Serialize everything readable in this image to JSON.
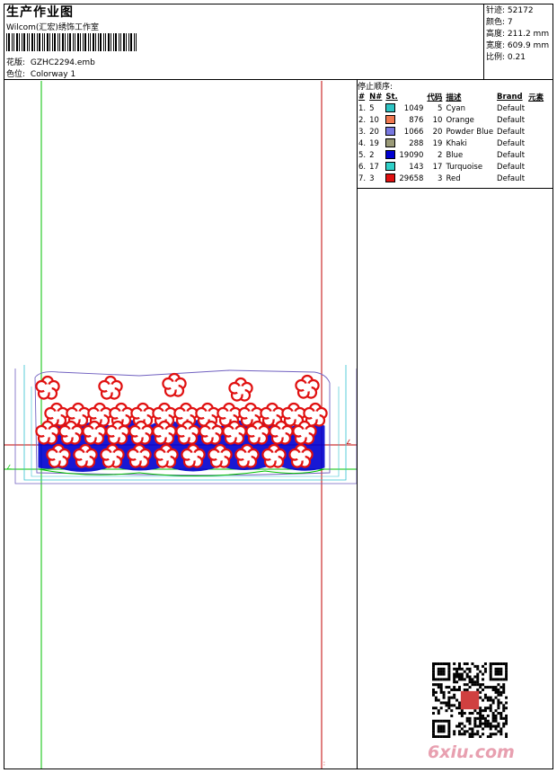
{
  "header": {
    "title": "生产作业图",
    "company": "Wilcom(汇宏)绣饰工作室",
    "pattern_label": "花版:",
    "pattern_value": "GZHC2294.emb",
    "colorway_label": "色位:",
    "colorway_value": "Colorway 1"
  },
  "stats": {
    "stitches_label": "针迹:",
    "stitches_value": "52172",
    "colors_label": "颜色:",
    "colors_value": "7",
    "height_label": "高度:",
    "height_value": "211.2 mm",
    "width_label": "宽度:",
    "width_value": "609.9 mm",
    "scale_label": "比例:",
    "scale_value": "0.21"
  },
  "stop_sequence": {
    "title": "停止顺序:",
    "headers": [
      "#",
      "N#",
      "St.",
      "代码",
      "描述",
      "Brand",
      "元素"
    ],
    "rows": [
      {
        "index": "1.",
        "n": "5",
        "color": "#2ec4c4",
        "stitches": "1049",
        "code": "5",
        "desc": "Cyan",
        "brand": "Default"
      },
      {
        "index": "2.",
        "n": "10",
        "color": "#f07850",
        "stitches": "876",
        "code": "10",
        "desc": "Orange",
        "brand": "Default"
      },
      {
        "index": "3.",
        "n": "20",
        "color": "#7878e0",
        "stitches": "1066",
        "code": "20",
        "desc": "Powder Blue",
        "brand": "Default"
      },
      {
        "index": "4.",
        "n": "19",
        "color": "#9a9a78",
        "stitches": "288",
        "code": "19",
        "desc": "Khaki",
        "brand": "Default"
      },
      {
        "index": "5.",
        "n": "2",
        "color": "#0000d0",
        "stitches": "19090",
        "code": "2",
        "desc": "Blue",
        "brand": "Default"
      },
      {
        "index": "6.",
        "n": "17",
        "color": "#30d0c8",
        "stitches": "143",
        "code": "17",
        "desc": "Turquoise",
        "brand": "Default"
      },
      {
        "index": "7.",
        "n": "3",
        "color": "#e01010",
        "stitches": "29658",
        "code": "3",
        "desc": "Red",
        "brand": "Default"
      }
    ]
  },
  "watermark": "6xiu.com",
  "colors": {
    "guide_green": "#00c000",
    "guide_red": "#c00000",
    "flower_red": "#e01010",
    "fill_blue": "#0000d0",
    "outline_cyan": "#30c0d0",
    "outline_purple": "#7060c0"
  }
}
